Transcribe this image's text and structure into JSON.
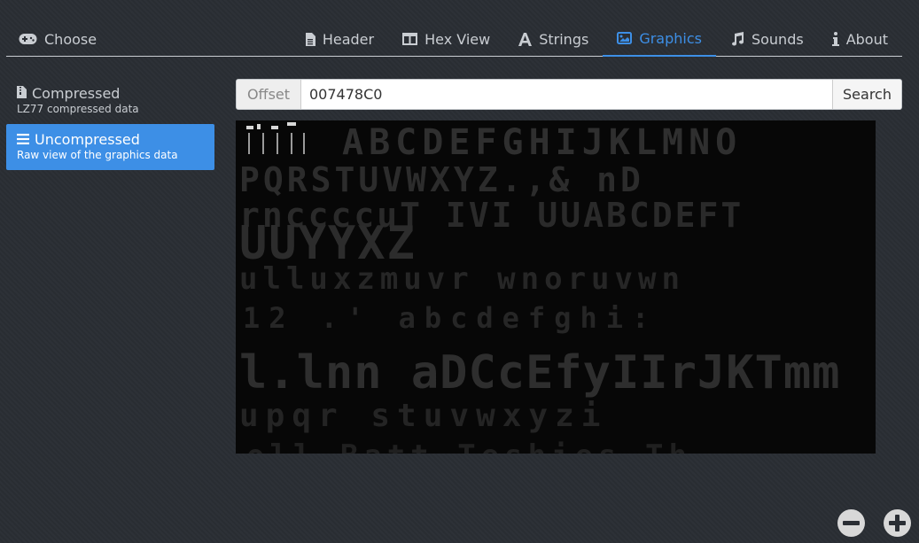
{
  "nav": {
    "brand": {
      "label": "Choose",
      "icon": "gamepad-icon"
    },
    "tabs": [
      {
        "label": "Header",
        "icon": "file-text-icon",
        "active": false
      },
      {
        "label": "Hex View",
        "icon": "columns-icon",
        "active": false
      },
      {
        "label": "Strings",
        "icon": "font-icon",
        "active": false
      },
      {
        "label": "Graphics",
        "icon": "image-icon",
        "active": true
      },
      {
        "label": "Sounds",
        "icon": "music-icon",
        "active": false
      },
      {
        "label": "About",
        "icon": "info-icon",
        "active": false
      }
    ]
  },
  "sidebar": {
    "items": [
      {
        "title": "Compressed",
        "subtitle": "LZ77 compressed data",
        "icon": "archive-file-icon",
        "active": false
      },
      {
        "title": "Uncompressed",
        "subtitle": "Raw view of the graphics data",
        "icon": "bars-icon",
        "active": true
      }
    ]
  },
  "offset": {
    "label": "Offset",
    "value": "007478C0",
    "button": "Search"
  },
  "graphics": {
    "rows": [
      "  ABCDEFGHIJKLMNO",
      "PQRSTUVWXYZ.,&  nD",
      "rnccccuT IVI UUABCDEFT",
      "UUYYXZ",
      "ulluxzmuvr wnoruvwn",
      "12  .'      abcdefghi:",
      "l.lnn aDCcEfyIIrJKTmm",
      "upqr stuvwxyzi",
      "oll Batt  Teshies  Th"
    ]
  },
  "colors": {
    "accent": "#3d8fe6",
    "background": "#2a2e34",
    "text": "#c9cdd2",
    "canvas": "#070707"
  },
  "zoom": {
    "out_icon": "minus-circle-icon",
    "in_icon": "plus-circle-icon"
  }
}
